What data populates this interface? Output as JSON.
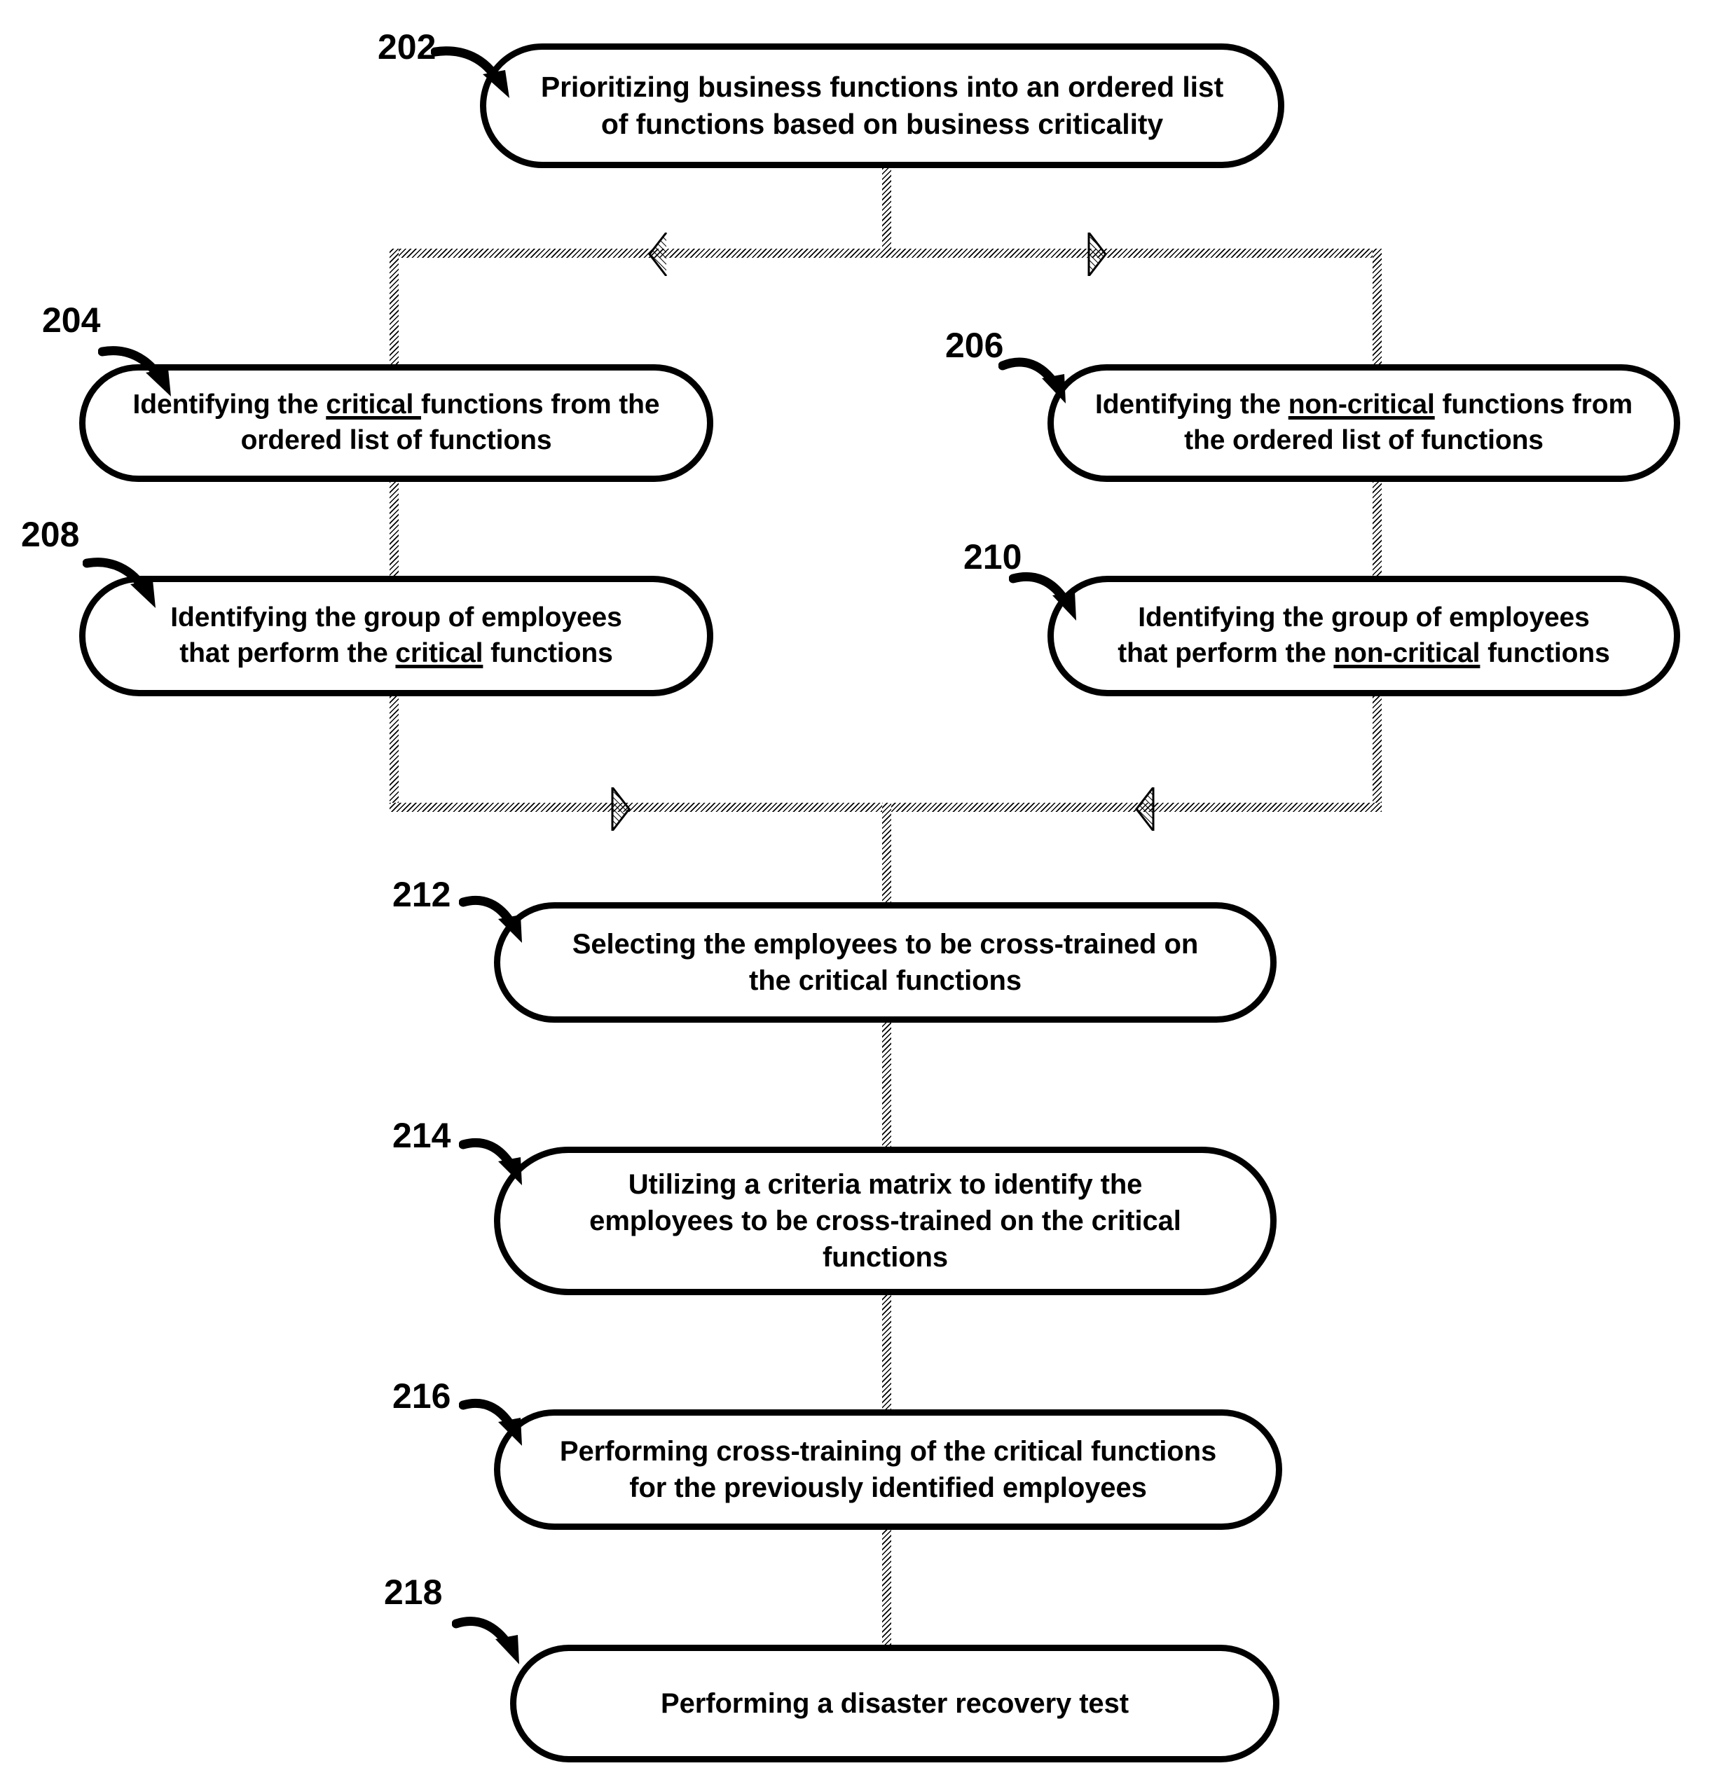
{
  "figure": {
    "type": "patent-flowchart",
    "title": "Cross-training process flowchart"
  },
  "nodes": [
    {
      "ref": "202",
      "name": "prioritizing-business-functions",
      "lines": [
        "Prioritizing business functions into an ordered list",
        "of functions based on business criticality"
      ],
      "text": "Prioritizing business functions into an ordered list of functions based on business criticality",
      "emphasis": []
    },
    {
      "ref": "204",
      "name": "identifying-critical-functions",
      "lines": [
        "Identifying the critical functions from the",
        "ordered list of functions"
      ],
      "text": "Identifying the critical functions from the ordered list of functions",
      "emphasis": [
        "critical "
      ]
    },
    {
      "ref": "206",
      "name": "identifying-non-critical-functions",
      "lines": [
        "Identifying the non-critical functions from",
        "the ordered list of functions"
      ],
      "text": "Identifying the non-critical functions from the ordered list of functions",
      "emphasis": [
        "non-critical"
      ]
    },
    {
      "ref": "208",
      "name": "identifying-employees-critical",
      "lines": [
        "Identifying the group of employees",
        "that perform the critical functions"
      ],
      "text": "Identifying the group of employees that perform the critical functions",
      "emphasis": [
        "critical"
      ]
    },
    {
      "ref": "210",
      "name": "identifying-employees-non-critical",
      "lines": [
        "Identifying the group of employees",
        "that perform the non-critical functions"
      ],
      "text": "Identifying the group of employees that perform the non-critical functions",
      "emphasis": [
        "non-critical"
      ]
    },
    {
      "ref": "212",
      "name": "selecting-employees-cross-trained",
      "lines": [
        "Selecting the employees to be cross-trained on",
        "the critical functions"
      ],
      "text": "Selecting the employees to be cross-trained on the critical functions",
      "emphasis": []
    },
    {
      "ref": "214",
      "name": "utilizing-criteria-matrix",
      "lines": [
        "Utilizing a criteria matrix to identify the",
        "employees to be cross-trained on the critical",
        "functions"
      ],
      "text": "Utilizing a criteria matrix to identify the employees to be cross-trained on the critical functions",
      "emphasis": []
    },
    {
      "ref": "216",
      "name": "performing-cross-training",
      "lines": [
        "Performing cross-training of the critical functions",
        "for the previously identified employees"
      ],
      "text": "Performing cross-training of the critical functions for the previously identified employees",
      "emphasis": []
    },
    {
      "ref": "218",
      "name": "performing-disaster-recovery-test",
      "lines": [
        "Performing a disaster recovery test"
      ],
      "text": "Performing a disaster recovery test",
      "emphasis": []
    }
  ],
  "colors": {
    "stroke": "#000000",
    "fill": "#ffffff"
  }
}
